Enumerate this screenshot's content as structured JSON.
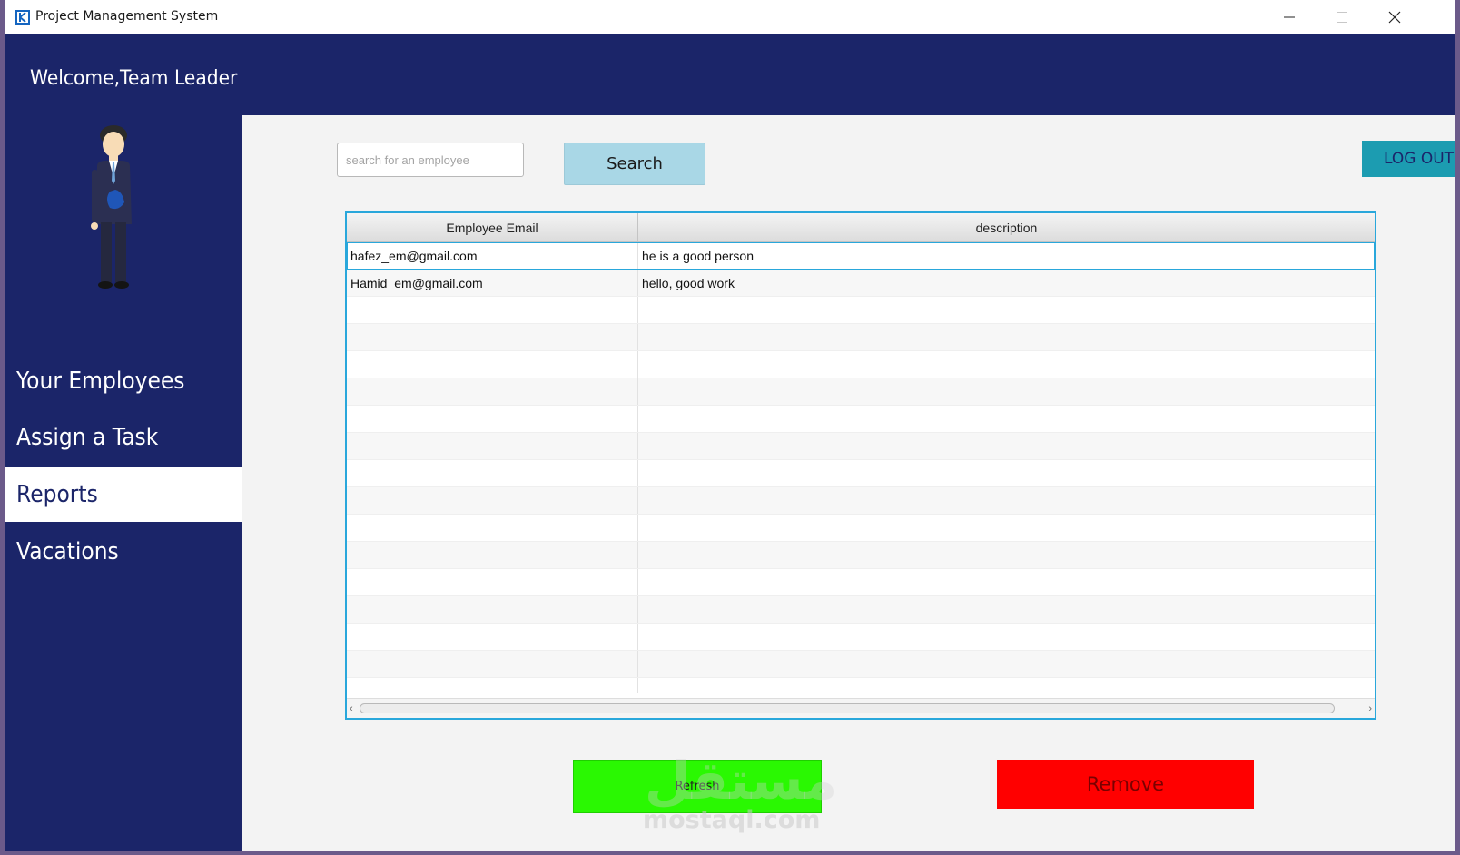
{
  "window": {
    "title": "Project Management System"
  },
  "header": {
    "welcome": "Welcome,Team Leader"
  },
  "sidebar": {
    "items": [
      {
        "label": "Your Employees",
        "active": false
      },
      {
        "label": "Assign a Task",
        "active": false
      },
      {
        "label": "Reports",
        "active": true
      },
      {
        "label": "Vacations",
        "active": false
      }
    ]
  },
  "search": {
    "placeholder": "search for an employee",
    "value": "",
    "button_label": "Search"
  },
  "logout": {
    "label": "LOG OUT"
  },
  "table": {
    "columns": [
      "Employee Email",
      "description"
    ],
    "rows": [
      [
        "hafez_em@gmail.com",
        "he is a good person"
      ],
      [
        "Hamid_em@gmail.com",
        "hello, good work"
      ],
      [
        "",
        ""
      ],
      [
        "",
        ""
      ],
      [
        "",
        ""
      ],
      [
        "",
        ""
      ],
      [
        "",
        ""
      ],
      [
        "",
        ""
      ],
      [
        "",
        ""
      ],
      [
        "",
        ""
      ],
      [
        "",
        ""
      ],
      [
        "",
        ""
      ],
      [
        "",
        ""
      ],
      [
        "",
        ""
      ],
      [
        "",
        ""
      ],
      [
        "",
        ""
      ],
      [
        "",
        ""
      ]
    ],
    "selected_row": 0
  },
  "actions": {
    "refresh_label": "Refresh",
    "remove_label": "Remove"
  },
  "watermark": {
    "arabic": "مستقل",
    "latin": "mostaql.com"
  },
  "colors": {
    "sidebar_bg": "#1b2569",
    "search_btn": "#a9d7e6",
    "logout_btn": "#1c9cb1",
    "refresh_btn": "#2af802",
    "remove_btn": "#ff0000",
    "table_border": "#29a7db"
  }
}
